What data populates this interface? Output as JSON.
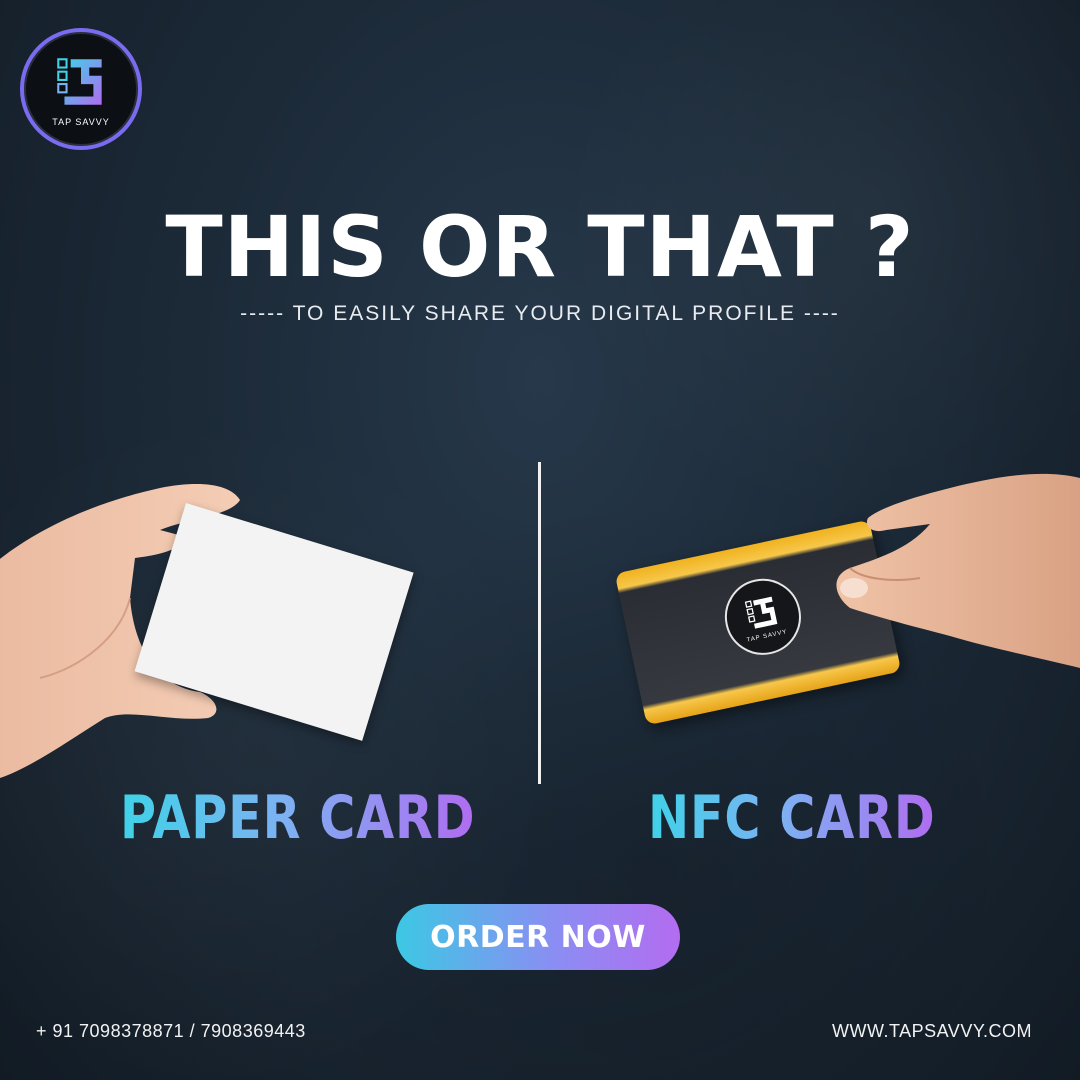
{
  "brand": {
    "logo_text": "TAP SAVVY",
    "accent": "#7a6cf0"
  },
  "headline": "THIS OR THAT ?",
  "subline": "----- TO EASILY SHARE YOUR DIGITAL PROFILE ----",
  "options": {
    "left_label": "PAPER CARD",
    "right_label": "NFC CARD",
    "nfc_card_logo_text": "TAP SAVVY"
  },
  "cta": {
    "label": "ORDER NOW"
  },
  "footer": {
    "phone": "+ 91 7098378871  /  7908369443",
    "website": "WWW.TAPSAVVY.COM"
  },
  "colors": {
    "background": "#1c2a38",
    "gradient_start": "#3fd2e8",
    "gradient_end": "#b06cf0",
    "card_gold": "#f0b21f"
  }
}
